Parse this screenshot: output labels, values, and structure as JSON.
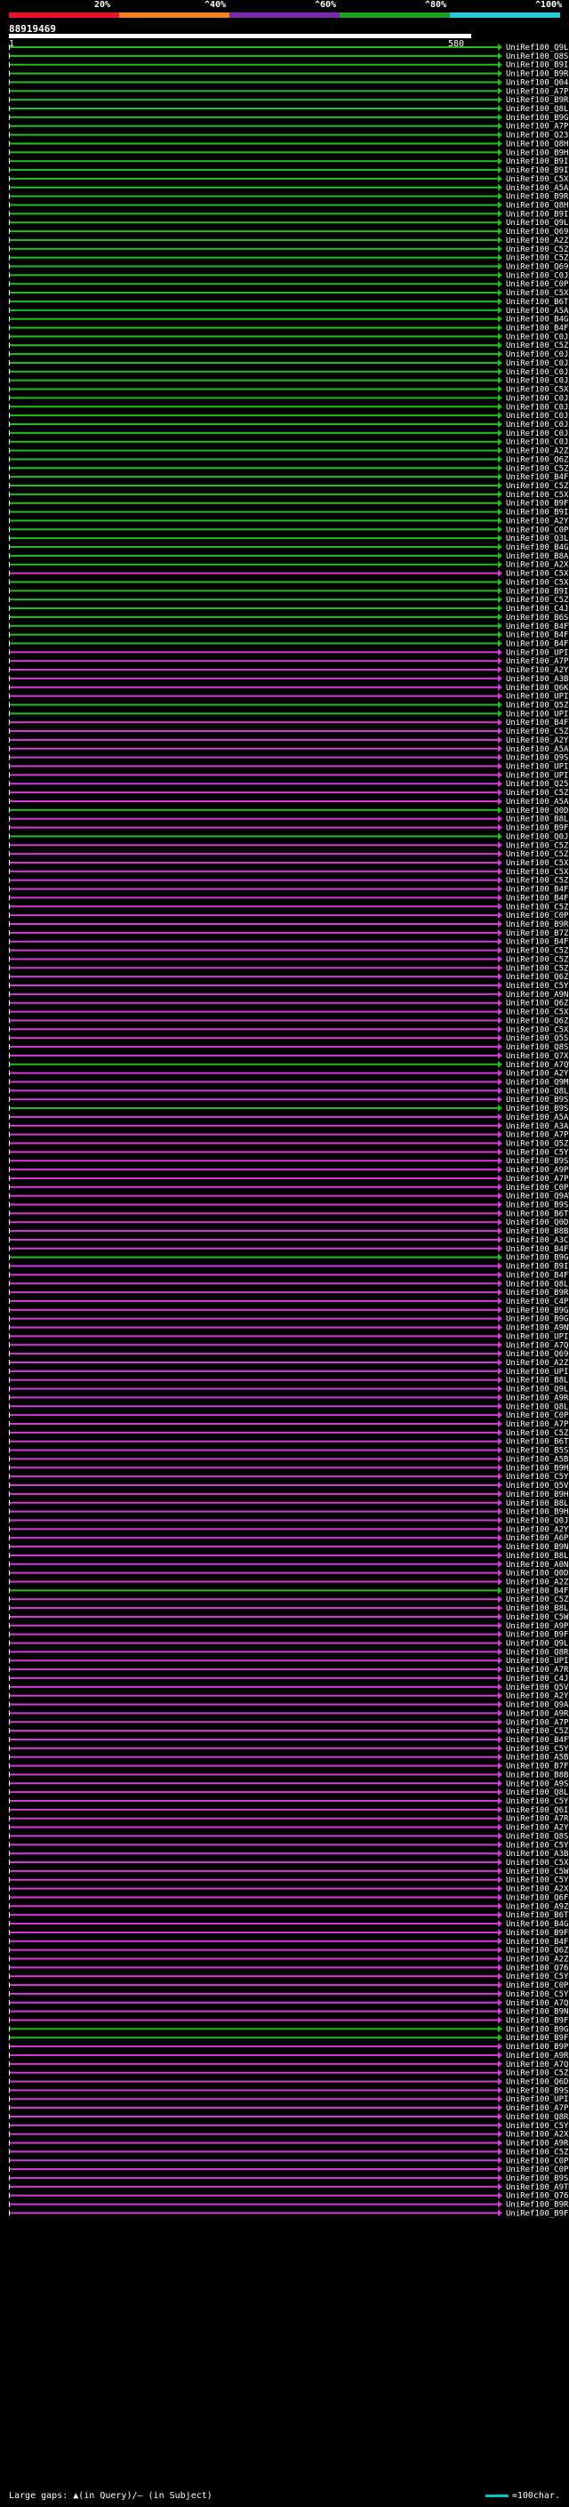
{
  "legend": {
    "colors": [
      "#e8122c",
      "#f08020",
      "#7a2aa8",
      "#20a020",
      "#28c8d8"
    ],
    "labels": [
      "20%",
      "^40%",
      "^60%",
      "^80%",
      "^100%"
    ]
  },
  "query_id": "88919469",
  "ruler": {
    "start": "1",
    "end": "580"
  },
  "hit_colors": {
    "purple": "#d83ad8",
    "green": "#20c020"
  },
  "hits": [
    {
      "id": "UniRef100_Q9LEW2",
      "color": "green"
    },
    {
      "id": "UniRef100_Q8S9J6",
      "color": "green"
    },
    {
      "id": "UniRef100_B9IL97",
      "color": "green"
    },
    {
      "id": "UniRef100_B9RNP9",
      "color": "green"
    },
    {
      "id": "UniRef100_Q04L59",
      "color": "green"
    },
    {
      "id": "UniRef100_A7P689",
      "color": "green"
    },
    {
      "id": "UniRef100_B9RNP7",
      "color": "green"
    },
    {
      "id": "UniRef100_Q8LK82",
      "color": "green"
    },
    {
      "id": "UniRef100_B9GZ03",
      "color": "green"
    },
    {
      "id": "UniRef100_A7P686",
      "color": "green"
    },
    {
      "id": "UniRef100_Q23792",
      "color": "green"
    },
    {
      "id": "UniRef100_Q8H9F4",
      "color": "green"
    },
    {
      "id": "UniRef100_B9HDQ8",
      "color": "green"
    },
    {
      "id": "UniRef100_B9IL99",
      "color": "green"
    },
    {
      "id": "UniRef100_B9ILA2",
      "color": "green"
    },
    {
      "id": "UniRef100_C5XZR3",
      "color": "green"
    },
    {
      "id": "UniRef100_A5AKS7",
      "color": "green"
    },
    {
      "id": "UniRef100_B9RNP8",
      "color": "green"
    },
    {
      "id": "UniRef100_Q8H7H9",
      "color": "green"
    },
    {
      "id": "UniRef100_B9ILA3",
      "color": "green"
    },
    {
      "id": "UniRef100_Q9LEW3",
      "color": "green"
    },
    {
      "id": "UniRef100_Q69QQ2",
      "color": "green"
    },
    {
      "id": "UniRef100_A2ZZG2",
      "color": "green"
    },
    {
      "id": "UniRef100_C5Z934",
      "color": "green"
    },
    {
      "id": "UniRef100_C5Z931",
      "color": "green"
    },
    {
      "id": "UniRef100_Q69XD4",
      "color": "green"
    },
    {
      "id": "UniRef100_C0JAZ9",
      "color": "green"
    },
    {
      "id": "UniRef100_C0P5R1",
      "color": "green"
    },
    {
      "id": "UniRef100_C5XZU2",
      "color": "green"
    },
    {
      "id": "UniRef100_B6TNN1",
      "color": "green"
    },
    {
      "id": "UniRef100_A5AKS8",
      "color": "green"
    },
    {
      "id": "UniRef100_B4G0X4",
      "color": "green"
    },
    {
      "id": "UniRef100_B4FR44",
      "color": "green"
    },
    {
      "id": "UniRef100_C0JBF0",
      "color": "green"
    },
    {
      "id": "UniRef100_C5Z374",
      "color": "green"
    },
    {
      "id": "UniRef100_C0JAB4",
      "color": "green"
    },
    {
      "id": "UniRef100_C0JAE2",
      "color": "green"
    },
    {
      "id": "UniRef100_C0JAC6",
      "color": "green"
    },
    {
      "id": "UniRef100_C0JA44",
      "color": "green"
    },
    {
      "id": "UniRef100_C5XZR2",
      "color": "green"
    },
    {
      "id": "UniRef100_C0JAA6",
      "color": "green"
    },
    {
      "id": "UniRef100_C0JA61",
      "color": "green"
    },
    {
      "id": "UniRef100_C0JA06",
      "color": "green"
    },
    {
      "id": "UniRef100_C0JA97",
      "color": "green"
    },
    {
      "id": "UniRef100_C0JA71",
      "color": "green"
    },
    {
      "id": "UniRef100_C0JA83",
      "color": "green"
    },
    {
      "id": "UniRef100_A2ZXI3",
      "color": "green"
    },
    {
      "id": "UniRef100_Q6Z674",
      "color": "green"
    },
    {
      "id": "UniRef100_C5Z905",
      "color": "green"
    },
    {
      "id": "UniRef100_B4FQ31",
      "color": "green"
    },
    {
      "id": "UniRef100_C5Z451",
      "color": "green"
    },
    {
      "id": "UniRef100_C5XSC7",
      "color": "green"
    },
    {
      "id": "UniRef100_B9FSX2",
      "color": "green"
    },
    {
      "id": "UniRef100_B9ILA4",
      "color": "green"
    },
    {
      "id": "UniRef100_A2YC53",
      "color": "green"
    },
    {
      "id": "UniRef100_C0PSS9",
      "color": "green"
    },
    {
      "id": "UniRef100_Q3L3E7",
      "color": "green"
    },
    {
      "id": "UniRef100_B4G0X2",
      "color": "green"
    },
    {
      "id": "UniRef100_B8ABK2",
      "color": "green"
    },
    {
      "id": "UniRef100_A2XSE2",
      "color": "green"
    },
    {
      "id": "UniRef100_C5X373",
      "color": "purple"
    },
    {
      "id": "UniRef100_C5XDX3",
      "color": "green"
    },
    {
      "id": "UniRef100_B9ILA0",
      "color": "green"
    },
    {
      "id": "UniRef100_C5Z0X3",
      "color": "green"
    },
    {
      "id": "UniRef100_C4J5P0",
      "color": "green"
    },
    {
      "id": "UniRef100_B6SL29",
      "color": "green"
    },
    {
      "id": "UniRef100_B4FWR4",
      "color": "green"
    },
    {
      "id": "UniRef100_B4FND8",
      "color": "green"
    },
    {
      "id": "UniRef100_B4FQ37",
      "color": "green"
    },
    {
      "id": "UniRef100_UPI000..",
      "color": "purple"
    },
    {
      "id": "UniRef100_A7PE90",
      "color": "purple"
    },
    {
      "id": "UniRef100_A2YBM7",
      "color": "purple"
    },
    {
      "id": "UniRef100_A3B7V2",
      "color": "purple"
    },
    {
      "id": "UniRef100_Q6K5F0",
      "color": "purple"
    },
    {
      "id": "UniRef100_UPI000..",
      "color": "purple"
    },
    {
      "id": "UniRef100_Q5Z4D4",
      "color": "green"
    },
    {
      "id": "UniRef100_UPI000..",
      "color": "green"
    },
    {
      "id": "UniRef100_B4FTJ2",
      "color": "purple"
    },
    {
      "id": "UniRef100_C5Z118",
      "color": "purple"
    },
    {
      "id": "UniRef100_A2YC51",
      "color": "purple"
    },
    {
      "id": "UniRef100_A5AVH3",
      "color": "purple"
    },
    {
      "id": "UniRef100_Q9SPQ0",
      "color": "purple"
    },
    {
      "id": "UniRef100_UPI000..",
      "color": "purple"
    },
    {
      "id": "UniRef100_UPI000..",
      "color": "purple"
    },
    {
      "id": "UniRef100_Q259J3",
      "color": "purple"
    },
    {
      "id": "UniRef100_C5Z955",
      "color": "purple"
    },
    {
      "id": "UniRef100_A5AL21",
      "color": "purple"
    },
    {
      "id": "UniRef100_Q0DYZ1",
      "color": "green"
    },
    {
      "id": "UniRef100_B8LKQ5",
      "color": "purple"
    },
    {
      "id": "UniRef100_B9FDH9",
      "color": "purple"
    },
    {
      "id": "UniRef100_Q0J912",
      "color": "green"
    },
    {
      "id": "UniRef100_C5Z277",
      "color": "purple"
    },
    {
      "id": "UniRef100_C5Z1K2",
      "color": "purple"
    },
    {
      "id": "UniRef100_C5XDX8",
      "color": "purple"
    },
    {
      "id": "UniRef100_C5XEC8",
      "color": "purple"
    },
    {
      "id": "UniRef100_C5Z962",
      "color": "purple"
    },
    {
      "id": "UniRef100_B4FX48",
      "color": "purple"
    },
    {
      "id": "UniRef100_B4FJM4",
      "color": "purple"
    },
    {
      "id": "UniRef100_C5Z9S4",
      "color": "purple"
    },
    {
      "id": "UniRef100_C0PDB4",
      "color": "purple"
    },
    {
      "id": "UniRef100_B9RGP5",
      "color": "purple"
    },
    {
      "id": "UniRef100_B7ZZY7",
      "color": "purple"
    },
    {
      "id": "UniRef100_B4FYP5",
      "color": "purple"
    },
    {
      "id": "UniRef100_C5Z1K3",
      "color": "purple"
    },
    {
      "id": "UniRef100_C5Z1K1",
      "color": "purple"
    },
    {
      "id": "UniRef100_C5Z9K0",
      "color": "purple"
    },
    {
      "id": "UniRef100_Q6Z670",
      "color": "purple"
    },
    {
      "id": "UniRef100_C5YK14",
      "color": "purple"
    },
    {
      "id": "UniRef100_A9NUE4",
      "color": "purple"
    },
    {
      "id": "UniRef100_Q6Z671",
      "color": "purple"
    },
    {
      "id": "UniRef100_C5X0P2",
      "color": "purple"
    },
    {
      "id": "UniRef100_Q6Z6R0",
      "color": "purple"
    },
    {
      "id": "UniRef100_C5XXD4",
      "color": "purple"
    },
    {
      "id": "UniRef100_Q5SQN3",
      "color": "purple"
    },
    {
      "id": "UniRef100_Q8S050",
      "color": "purple"
    },
    {
      "id": "UniRef100_Q7XHB9",
      "color": "purple"
    },
    {
      "id": "UniRef100_A7QW34",
      "color": "green"
    },
    {
      "id": "UniRef100_A2YC46",
      "color": "purple"
    },
    {
      "id": "UniRef100_Q9M356",
      "color": "purple"
    },
    {
      "id": "UniRef100_Q8L983",
      "color": "purple"
    },
    {
      "id": "UniRef100_B9SP52",
      "color": "purple"
    },
    {
      "id": "UniRef100_B9SR19",
      "color": "green"
    },
    {
      "id": "UniRef100_A5AKV9",
      "color": "purple"
    },
    {
      "id": "UniRef100_A3AHH1",
      "color": "purple"
    },
    {
      "id": "UniRef100_A7PVJ5",
      "color": "purple"
    },
    {
      "id": "UniRef100_Q5Z4E5",
      "color": "purple"
    },
    {
      "id": "UniRef100_C5YJX2",
      "color": "purple"
    },
    {
      "id": "UniRef100_B9SX53",
      "color": "purple"
    },
    {
      "id": "UniRef100_A9PGB5",
      "color": "purple"
    },
    {
      "id": "UniRef100_A7P3S1",
      "color": "purple"
    },
    {
      "id": "UniRef100_C0P738",
      "color": "purple"
    },
    {
      "id": "UniRef100_Q9AWT3",
      "color": "purple"
    },
    {
      "id": "UniRef100_B9S8G8",
      "color": "purple"
    },
    {
      "id": "UniRef100_B6TBN8",
      "color": "purple"
    },
    {
      "id": "UniRef100_Q0DF20",
      "color": "purple"
    },
    {
      "id": "UniRef100_B8B1W8",
      "color": "purple"
    },
    {
      "id": "UniRef100_A3C7W4",
      "color": "purple"
    },
    {
      "id": "UniRef100_B4FV10",
      "color": "purple"
    },
    {
      "id": "UniRef100_B9GLP4",
      "color": "green"
    },
    {
      "id": "UniRef100_B9I8Y7",
      "color": "purple"
    },
    {
      "id": "UniRef100_B4FVK3",
      "color": "purple"
    },
    {
      "id": "UniRef100_Q8LHE3",
      "color": "purple"
    },
    {
      "id": "UniRef100_B9RS10",
      "color": "purple"
    },
    {
      "id": "UniRef100_C4PSS2",
      "color": "purple"
    },
    {
      "id": "UniRef100_B9GEZ3",
      "color": "purple"
    },
    {
      "id": "UniRef100_B9GVV5",
      "color": "purple"
    },
    {
      "id": "UniRef100_A9NW06",
      "color": "purple"
    },
    {
      "id": "UniRef100_UPI000..",
      "color": "purple"
    },
    {
      "id": "UniRef100_A7QNM3",
      "color": "purple"
    },
    {
      "id": "UniRef100_Q69P39",
      "color": "purple"
    },
    {
      "id": "UniRef100_A2Z1D3",
      "color": "purple"
    },
    {
      "id": "UniRef100_UPI000..",
      "color": "purple"
    },
    {
      "id": "UniRef100_B8LRL7",
      "color": "purple"
    },
    {
      "id": "UniRef100_Q9LNJ3",
      "color": "purple"
    },
    {
      "id": "UniRef100_A9R5N4",
      "color": "purple"
    },
    {
      "id": "UniRef100_Q8L9B9",
      "color": "purple"
    },
    {
      "id": "UniRef100_C0PSK0",
      "color": "purple"
    },
    {
      "id": "UniRef100_A7PGQ3",
      "color": "purple"
    },
    {
      "id": "UniRef100_C5Z958",
      "color": "purple"
    },
    {
      "id": "UniRef100_B6TTR6",
      "color": "purple"
    },
    {
      "id": "UniRef100_B5ST28",
      "color": "purple"
    },
    {
      "id": "UniRef100_A5BJK6",
      "color": "purple"
    },
    {
      "id": "UniRef100_B9HAX9",
      "color": "purple"
    },
    {
      "id": "UniRef100_C5Y817",
      "color": "purple"
    },
    {
      "id": "UniRef100_Q5VQ83",
      "color": "purple"
    },
    {
      "id": "UniRef100_B9HER8",
      "color": "purple"
    },
    {
      "id": "UniRef100_B8LN55",
      "color": "purple"
    },
    {
      "id": "UniRef100_B9H484",
      "color": "purple"
    },
    {
      "id": "UniRef100_Q0JTJ6",
      "color": "purple"
    },
    {
      "id": "UniRef100_A2YT82",
      "color": "purple"
    },
    {
      "id": "UniRef100_A6P5K2",
      "color": "purple"
    },
    {
      "id": "UniRef100_B9N2X4",
      "color": "purple"
    },
    {
      "id": "UniRef100_B8LPJ6",
      "color": "purple"
    },
    {
      "id": "UniRef100_A0NV19",
      "color": "purple"
    },
    {
      "id": "UniRef100_Q0DF21",
      "color": "purple"
    },
    {
      "id": "UniRef100_A2ZTH6",
      "color": "purple"
    },
    {
      "id": "UniRef100_B4FA66",
      "color": "green"
    },
    {
      "id": "UniRef100_C5Z074",
      "color": "purple"
    },
    {
      "id": "UniRef100_B8LLE4",
      "color": "purple"
    },
    {
      "id": "UniRef100_C5WQZ5",
      "color": "purple"
    },
    {
      "id": "UniRef100_A9PYP4",
      "color": "purple"
    },
    {
      "id": "UniRef100_B9FR99",
      "color": "purple"
    },
    {
      "id": "UniRef100_Q9LS40",
      "color": "purple"
    },
    {
      "id": "UniRef100_Q8RYI1",
      "color": "purple"
    },
    {
      "id": "UniRef100_UPI000..",
      "color": "purple"
    },
    {
      "id": "UniRef100_A7R001",
      "color": "purple"
    },
    {
      "id": "UniRef100_C4J629",
      "color": "purple"
    },
    {
      "id": "UniRef100_Q5VPR6",
      "color": "purple"
    },
    {
      "id": "UniRef100_A2YXL7",
      "color": "purple"
    },
    {
      "id": "UniRef100_Q9AD20",
      "color": "purple"
    },
    {
      "id": "UniRef100_A9RX82",
      "color": "purple"
    },
    {
      "id": "UniRef100_A7PLX8",
      "color": "purple"
    },
    {
      "id": "UniRef100_C5Z957",
      "color": "purple"
    },
    {
      "id": "UniRef100_B4FW43",
      "color": "purple"
    },
    {
      "id": "UniRef100_C5YSW8",
      "color": "purple"
    },
    {
      "id": "UniRef100_A5BQ83",
      "color": "purple"
    },
    {
      "id": "UniRef100_B7FLG1",
      "color": "purple"
    },
    {
      "id": "UniRef100_B8B824",
      "color": "purple"
    },
    {
      "id": "UniRef100_A9SFP3",
      "color": "purple"
    },
    {
      "id": "UniRef100_Q8LHE4",
      "color": "purple"
    },
    {
      "id": "UniRef100_C5YS34",
      "color": "purple"
    },
    {
      "id": "UniRef100_Q6I5E1",
      "color": "purple"
    },
    {
      "id": "UniRef100_A7R484",
      "color": "purple"
    },
    {
      "id": "UniRef100_A2YB30",
      "color": "purple"
    },
    {
      "id": "UniRef100_Q8S4D7",
      "color": "purple"
    },
    {
      "id": "UniRef100_C5Y3W2",
      "color": "purple"
    },
    {
      "id": "UniRef100_A3BFC3",
      "color": "purple"
    },
    {
      "id": "UniRef100_C5XKE0",
      "color": "purple"
    },
    {
      "id": "UniRef100_C5WUW3",
      "color": "purple"
    },
    {
      "id": "UniRef100_C5YSW9",
      "color": "purple"
    },
    {
      "id": "UniRef100_A2XDB9",
      "color": "purple"
    },
    {
      "id": "UniRef100_Q6F4M5",
      "color": "purple"
    },
    {
      "id": "UniRef100_A9ZMF9",
      "color": "purple"
    },
    {
      "id": "UniRef100_B6TE66",
      "color": "purple"
    },
    {
      "id": "UniRef100_B4G9Y7",
      "color": "purple"
    },
    {
      "id": "UniRef100_B9FMW6",
      "color": "purple"
    },
    {
      "id": "UniRef100_B4FBF5",
      "color": "purple"
    },
    {
      "id": "UniRef100_Q6Z6Q8",
      "color": "purple"
    },
    {
      "id": "UniRef100_A2Z403",
      "color": "purple"
    },
    {
      "id": "UniRef100_Q766C3",
      "color": "purple"
    },
    {
      "id": "UniRef100_C5YSX0",
      "color": "purple"
    },
    {
      "id": "UniRef100_C0PGW9",
      "color": "purple"
    },
    {
      "id": "UniRef100_C5Y3W6",
      "color": "purple"
    },
    {
      "id": "UniRef100_A7QKP9",
      "color": "purple"
    },
    {
      "id": "UniRef100_B9NZJ4",
      "color": "purple"
    },
    {
      "id": "UniRef100_B9FI59",
      "color": "purple"
    },
    {
      "id": "UniRef100_B9GH97",
      "color": "green"
    },
    {
      "id": "UniRef100_B9FU43",
      "color": "green"
    },
    {
      "id": "UniRef100_B9PDF6",
      "color": "purple"
    },
    {
      "id": "UniRef100_A9RF88",
      "color": "purple"
    },
    {
      "id": "UniRef100_A7QH76",
      "color": "purple"
    },
    {
      "id": "UniRef100_C5Z779",
      "color": "purple"
    },
    {
      "id": "UniRef100_Q6DUM7",
      "color": "purple"
    },
    {
      "id": "UniRef100_B9SE12",
      "color": "purple"
    },
    {
      "id": "UniRef100_UPI000..",
      "color": "purple"
    },
    {
      "id": "UniRef100_A7PKN4",
      "color": "purple"
    },
    {
      "id": "UniRef100_Q8RYK3",
      "color": "purple"
    },
    {
      "id": "UniRef100_C5YIC7",
      "color": "purple"
    },
    {
      "id": "UniRef100_A2XE76",
      "color": "purple"
    },
    {
      "id": "UniRef100_A9RRL7",
      "color": "purple"
    },
    {
      "id": "UniRef100_C5ZDV5",
      "color": "purple"
    },
    {
      "id": "UniRef100_C0P5K7",
      "color": "purple"
    },
    {
      "id": "UniRef100_C0PGI3",
      "color": "purple"
    },
    {
      "id": "UniRef100_B9SA05",
      "color": "purple"
    },
    {
      "id": "UniRef100_A9TM24",
      "color": "purple"
    },
    {
      "id": "UniRef100_Q766C2",
      "color": "purple"
    },
    {
      "id": "UniRef100_B9RJV7",
      "color": "purple"
    },
    {
      "id": "UniRef100_B9FX78",
      "color": "purple"
    }
  ],
  "footer": {
    "left": "Large gaps: ▲(in Query)/– (in Subject)",
    "right": "=100char."
  }
}
